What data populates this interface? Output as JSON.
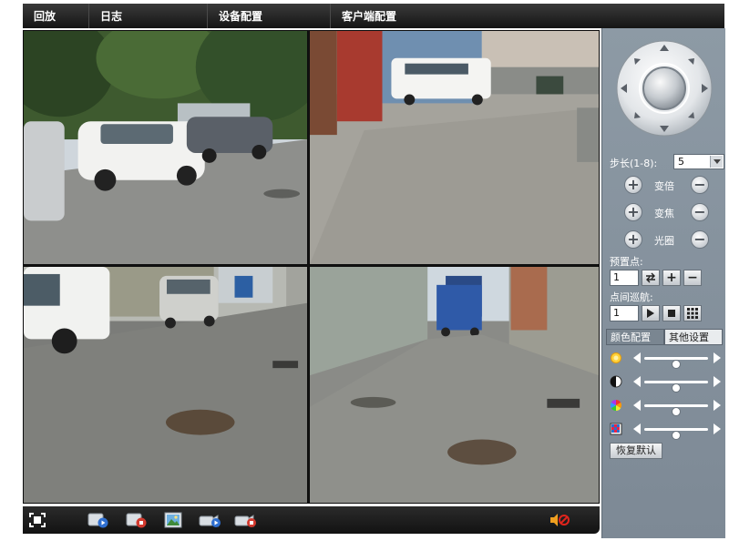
{
  "menu": {
    "items": [
      {
        "id": "playback",
        "label": "回放"
      },
      {
        "id": "log",
        "label": "日志"
      },
      {
        "id": "device",
        "label": "设备配置"
      },
      {
        "id": "client",
        "label": "客户端配置"
      }
    ]
  },
  "cameras": [
    {
      "id": "cam-1",
      "scene": "parking-lot-trees"
    },
    {
      "id": "cam-2",
      "scene": "gate-white-van"
    },
    {
      "id": "cam-3",
      "scene": "lane-parked-cars"
    },
    {
      "id": "cam-4",
      "scene": "alley-blue-truck"
    }
  ],
  "toolbar": {
    "buttons": [
      {
        "id": "fullscreen",
        "icon": "fullscreen-icon"
      },
      {
        "id": "play-all",
        "icon": "play-video-icon"
      },
      {
        "id": "stop-all",
        "icon": "stop-video-icon"
      },
      {
        "id": "snapshot",
        "icon": "snapshot-icon"
      },
      {
        "id": "record-start",
        "icon": "record-start-icon"
      },
      {
        "id": "record-stop",
        "icon": "record-stop-icon"
      }
    ],
    "volume": {
      "icon": "speaker-muted-icon",
      "muted": true
    }
  },
  "ptz": {
    "step_label": "步长(1-8):",
    "step_value": "5",
    "zoom_label": "变倍",
    "focus_label": "变焦",
    "iris_label": "光圈",
    "preset_label": "预置点:",
    "preset_value": "1",
    "cruise_label": "点间巡航:",
    "cruise_value": "1"
  },
  "color_config": {
    "tabs": [
      {
        "id": "color",
        "label": "颜色配置",
        "active": true
      },
      {
        "id": "other",
        "label": "其他设置",
        "active": false
      }
    ],
    "sliders": [
      {
        "id": "brightness",
        "icon": "brightness-icon",
        "value": 0.5
      },
      {
        "id": "contrast",
        "icon": "contrast-icon",
        "value": 0.5
      },
      {
        "id": "saturation",
        "icon": "saturation-icon",
        "value": 0.5
      },
      {
        "id": "sharpness",
        "icon": "sharpness-icon",
        "value": 0.5
      }
    ],
    "restore_label": "恢复默认"
  },
  "colors": {
    "menubar": "#1f1f1f",
    "panel": "#85929d",
    "mute_red": "#e0241c",
    "volume_orange": "#f0a020"
  }
}
